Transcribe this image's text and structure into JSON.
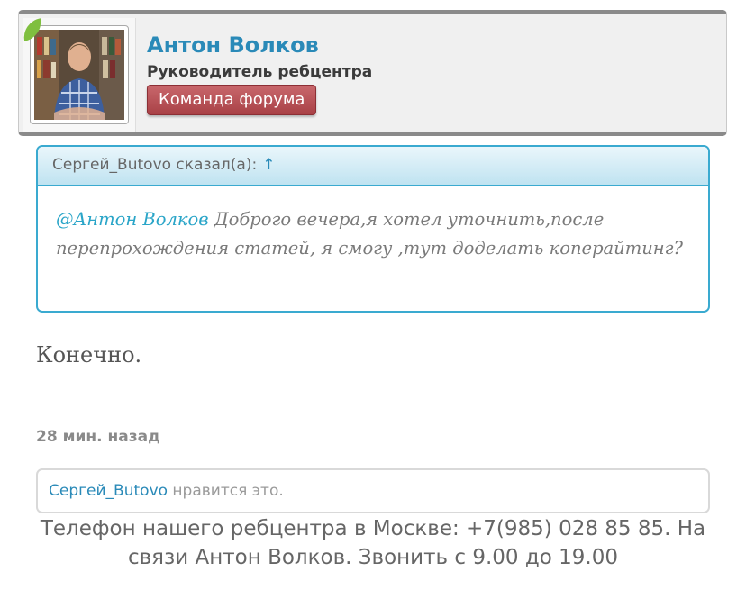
{
  "author": {
    "name": "Антон Волков",
    "role": "Руководитель ребцентра",
    "badge": "Команда форума",
    "avatar_icon": "person-portrait-icon",
    "leaf_icon": "leaf-icon"
  },
  "quote": {
    "author": "Сергей_Butovo сказал(а):",
    "jump_arrow": "↑",
    "mention": "@Антон Волков",
    "text": " Доброго вечера,я хотел уточнить,после перепрохождения статей, я смогу ,тут доделать копeрайтинг?"
  },
  "post": {
    "reply": "Конечно.",
    "time": "28 мин. назад"
  },
  "likes": {
    "user": "Сергей_Butovo",
    "suffix": " нравится это."
  },
  "footer": {
    "text": "Телефон нашего ребцентра в Москве: +7(985) 028 85 85. На связи Антон Волков. Звонить с 9.00 до 19.00"
  },
  "colors": {
    "link": "#2a8ab8",
    "quote_border": "#3aaad0",
    "badge": "#b04a4f"
  }
}
